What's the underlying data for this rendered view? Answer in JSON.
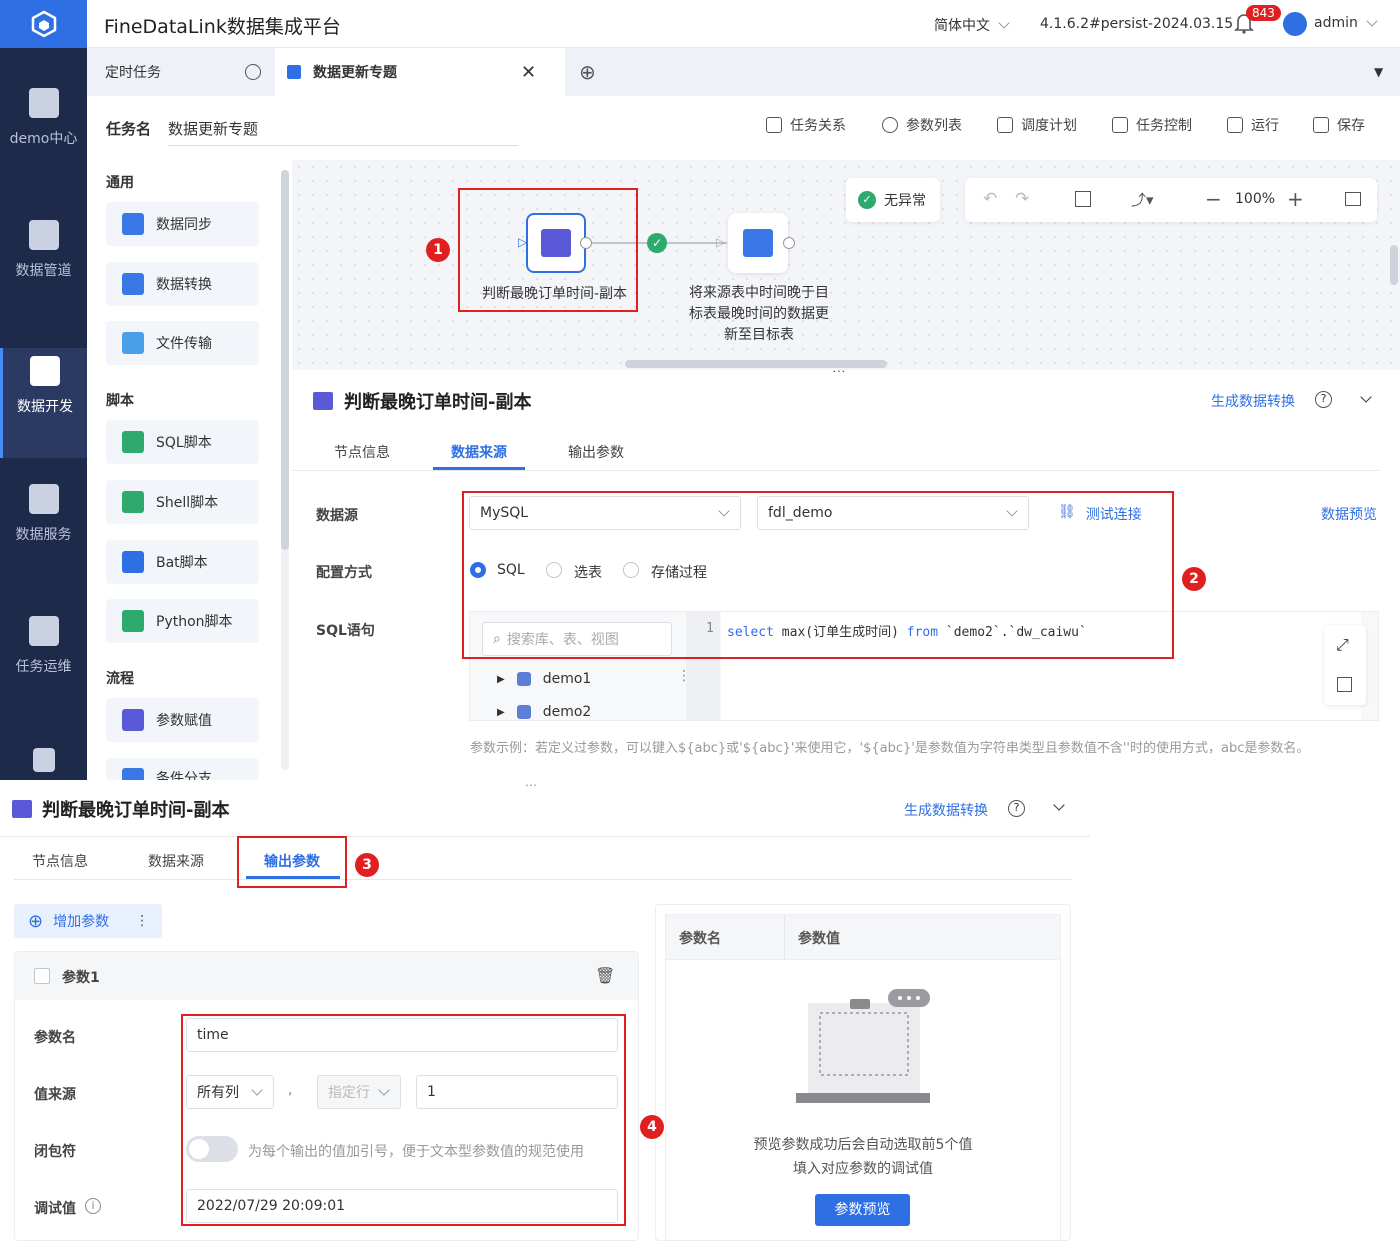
{
  "app": {
    "title": "FineDataLink数据集成平台",
    "language": "简体中文",
    "version": "4.1.6.2#persist-2024.03.15",
    "notifications": "843",
    "user": "admin"
  },
  "sidenav": {
    "items": [
      {
        "label": "demo中心",
        "icon": "home-icon"
      },
      {
        "label": "数据管道",
        "icon": "pipeline-icon"
      },
      {
        "label": "数据开发",
        "icon": "dev-icon"
      },
      {
        "label": "数据服务",
        "icon": "service-icon"
      },
      {
        "label": "任务运维",
        "icon": "ops-icon"
      }
    ]
  },
  "tabs": [
    {
      "label": "定时任务"
    },
    {
      "label": "数据更新专题"
    }
  ],
  "taskbar": {
    "name_label": "任务名",
    "name_value": "数据更新专题",
    "actions": [
      "任务关系",
      "参数列表",
      "调度计划",
      "任务控制",
      "运行",
      "保存"
    ]
  },
  "palette": {
    "sections": [
      {
        "title": "通用",
        "items": [
          "数据同步",
          "数据转换",
          "文件传输"
        ]
      },
      {
        "title": "脚本",
        "items": [
          "SQL脚本",
          "Shell脚本",
          "Bat脚本",
          "Python脚本"
        ]
      },
      {
        "title": "流程",
        "items": [
          "参数赋值",
          "条件分支"
        ]
      }
    ]
  },
  "canvas": {
    "status": "无异常",
    "zoom": "100%",
    "node1": "判断最晚订单时间-副本",
    "node2": "将来源表中时间晚于目标表最晚时间的数据更新至目标表"
  },
  "detail": {
    "title": "判断最晚订单时间-副本",
    "gen_link": "生成数据转换",
    "tabs": [
      "节点信息",
      "数据来源",
      "输出参数"
    ],
    "datasource_label": "数据源",
    "datasource_type": "MySQL",
    "datasource_db": "fdl_demo",
    "test_conn": "测试连接",
    "preview_data": "数据预览",
    "config_label": "配置方式",
    "config_options": [
      "SQL",
      "选表",
      "存储过程"
    ],
    "sql_label": "SQL语句",
    "search_placeholder": "搜索库、表、视图",
    "tree": [
      "demo1",
      "demo2"
    ],
    "sql_line_no": "1",
    "sql_kw1": "select",
    "sql_mid": " max(订单生成时间) ",
    "sql_kw2": "from",
    "sql_tail": " `demo2`.`dw_caiwu`",
    "hint": "参数示例：若定义过参数，可以键入${abc}或'${abc}'来使用它，'${abc}'是参数值为字符串类型且参数值不含''时的使用方式，abc是参数名。"
  },
  "bottom": {
    "title": "判断最晚订单时间-副本",
    "gen_link": "生成数据转换",
    "tabs": [
      "节点信息",
      "数据来源",
      "输出参数"
    ],
    "add_param": "增加参数",
    "param_title": "参数1",
    "name_label": "参数名",
    "name_value": "time",
    "source_label": "值来源",
    "source_col": "所有列",
    "source_row": "指定行",
    "source_num": "1",
    "wrap_label": "闭包符",
    "wrap_hint": "为每个输出的值加引号，便于文本型参数值的规范使用",
    "debug_label": "调试值",
    "debug_value": "2022/07/29 20:09:01",
    "table_headers": [
      "参数名",
      "参数值"
    ],
    "empty_line1": "预览参数成功后会自动选取前5个值",
    "empty_line2": "填入对应参数的调试值",
    "preview_btn": "参数预览"
  },
  "badges": [
    "1",
    "2",
    "3",
    "4"
  ],
  "colors": {
    "accent": "#2f6fe4",
    "nav": "#1e2a4a",
    "highlight": "#e02020"
  }
}
